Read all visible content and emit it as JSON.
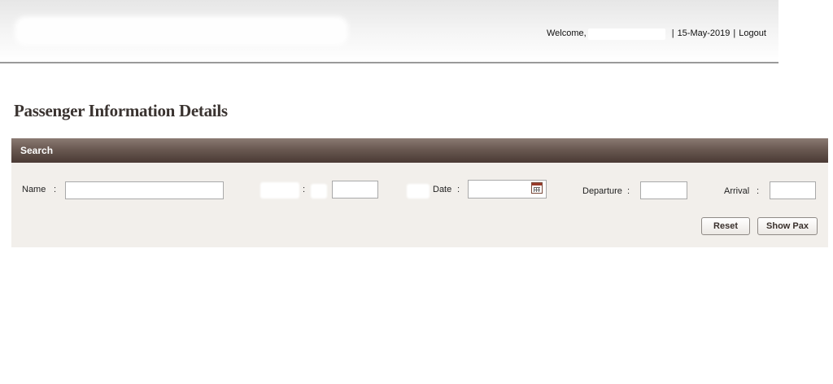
{
  "header": {
    "welcome_label": "Welcome,",
    "date": "15-May-2019",
    "logout_label": "Logout"
  },
  "page": {
    "title": "Passenger Information Details"
  },
  "search": {
    "section_label": "Search",
    "fields": {
      "name_label": "Name",
      "name_value": "",
      "field2_value": "",
      "date_label": "Date",
      "date_value": "",
      "departure_label": "Departure",
      "departure_value": "",
      "arrival_label": "Arrival",
      "arrival_value": "",
      "colon": ":"
    },
    "buttons": {
      "reset_label": "Reset",
      "show_pax_label": "Show Pax"
    }
  },
  "icons": {
    "calendar": "calendar-icon"
  },
  "colors": {
    "search_bar": "#5e4e47",
    "search_body": "#f2efeb",
    "title": "#3a3330"
  }
}
